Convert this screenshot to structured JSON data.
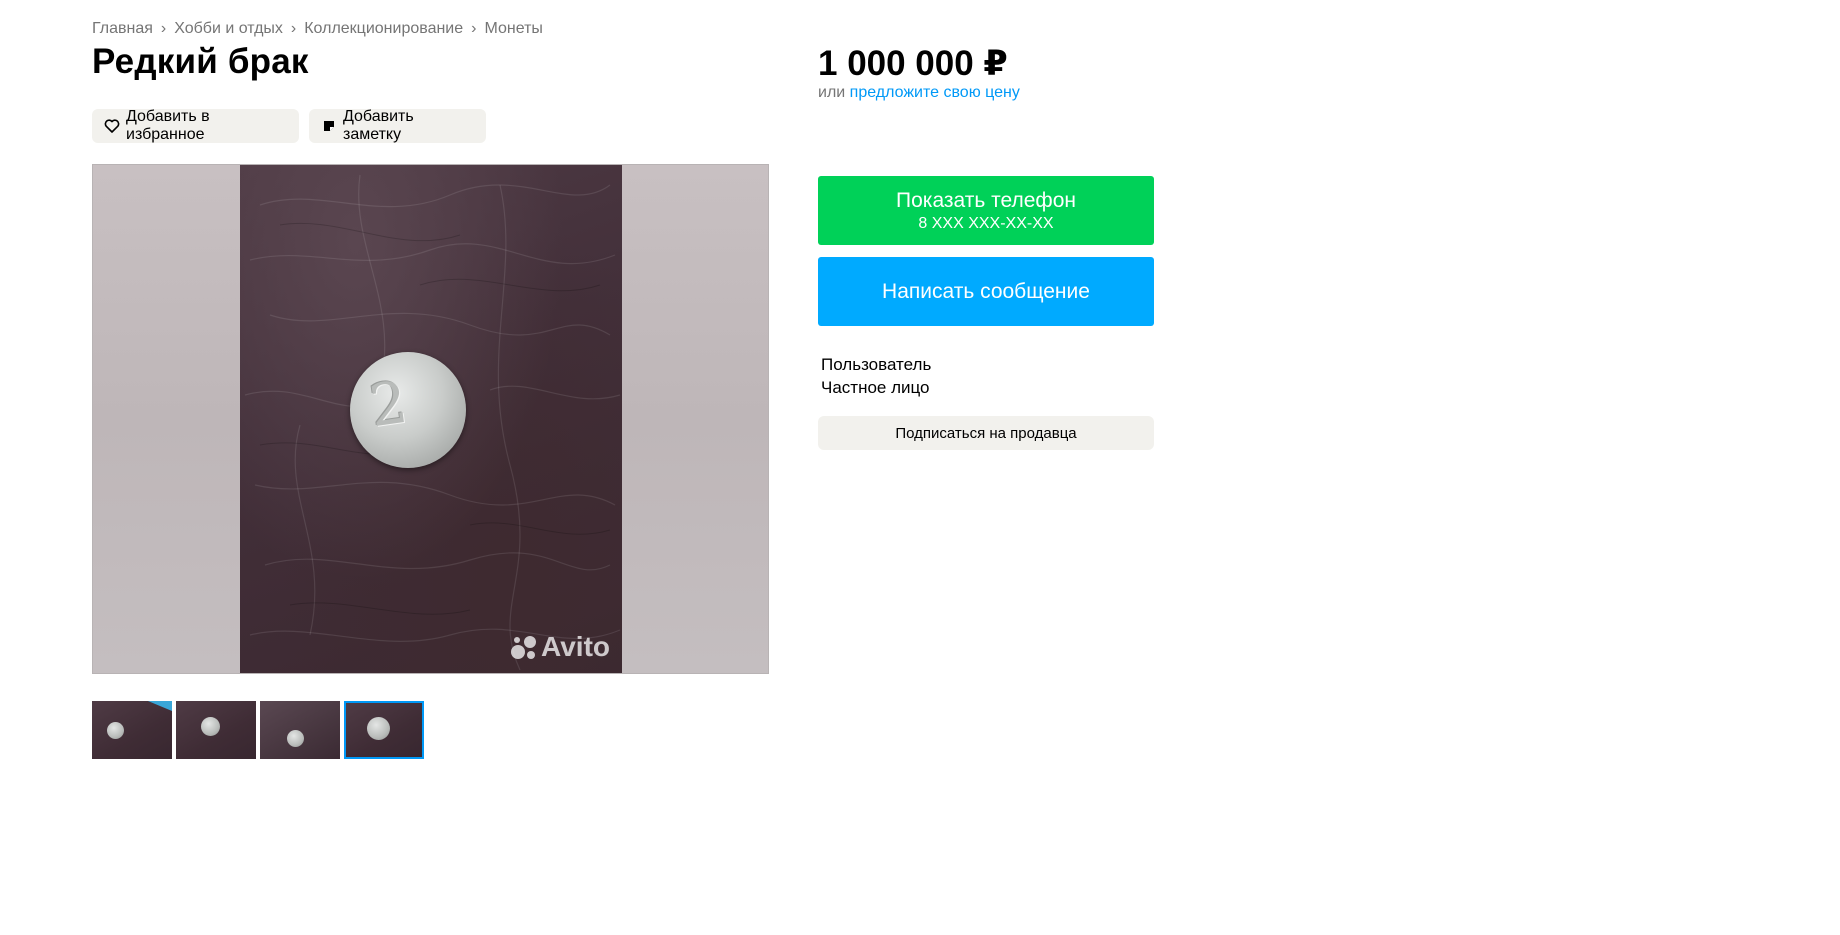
{
  "breadcrumbs": [
    "Главная",
    "Хобби и отдых",
    "Коллекционирование",
    "Монеты"
  ],
  "title": "Редкий брак",
  "actions": {
    "favorite": "Добавить в избранное",
    "note": "Добавить заметку"
  },
  "gallery": {
    "coin_numeral": "2",
    "watermark": "Avito",
    "thumbnail_count": 4,
    "active_thumbnail": 4
  },
  "price": {
    "amount": "1 000 000 ₽",
    "or": "или",
    "offer_link": "предложите свою цену"
  },
  "contact": {
    "phone_label": "Показать телефон",
    "phone_mask": "8 XXX XXX-XX-XX",
    "message_label": "Написать сообщение"
  },
  "seller": {
    "name": "Пользователь",
    "type": "Частное лицо",
    "subscribe_label": "Подписаться на продавца"
  },
  "colors": {
    "green": "#00d158",
    "blue": "#00aaff",
    "link": "#0099f7",
    "muted_button": "#f2f1ed"
  }
}
